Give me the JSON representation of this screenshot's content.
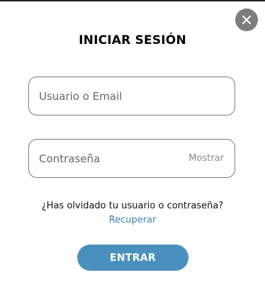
{
  "modal": {
    "title": "INICIAR SESIÓN",
    "close_icon": "close-icon"
  },
  "form": {
    "username": {
      "value": "",
      "placeholder": "Usuario o Email"
    },
    "password": {
      "value": "",
      "placeholder": "Contraseña",
      "show_label": "Mostrar"
    },
    "forgot_text": "¿Has olvidado tu usuario o contraseña?",
    "recover_link": "Recuperar",
    "submit_label": "ENTRAR"
  },
  "colors": {
    "accent": "#4a90bf",
    "link": "#3d7fb5",
    "close_bg": "#7d7d7d"
  }
}
